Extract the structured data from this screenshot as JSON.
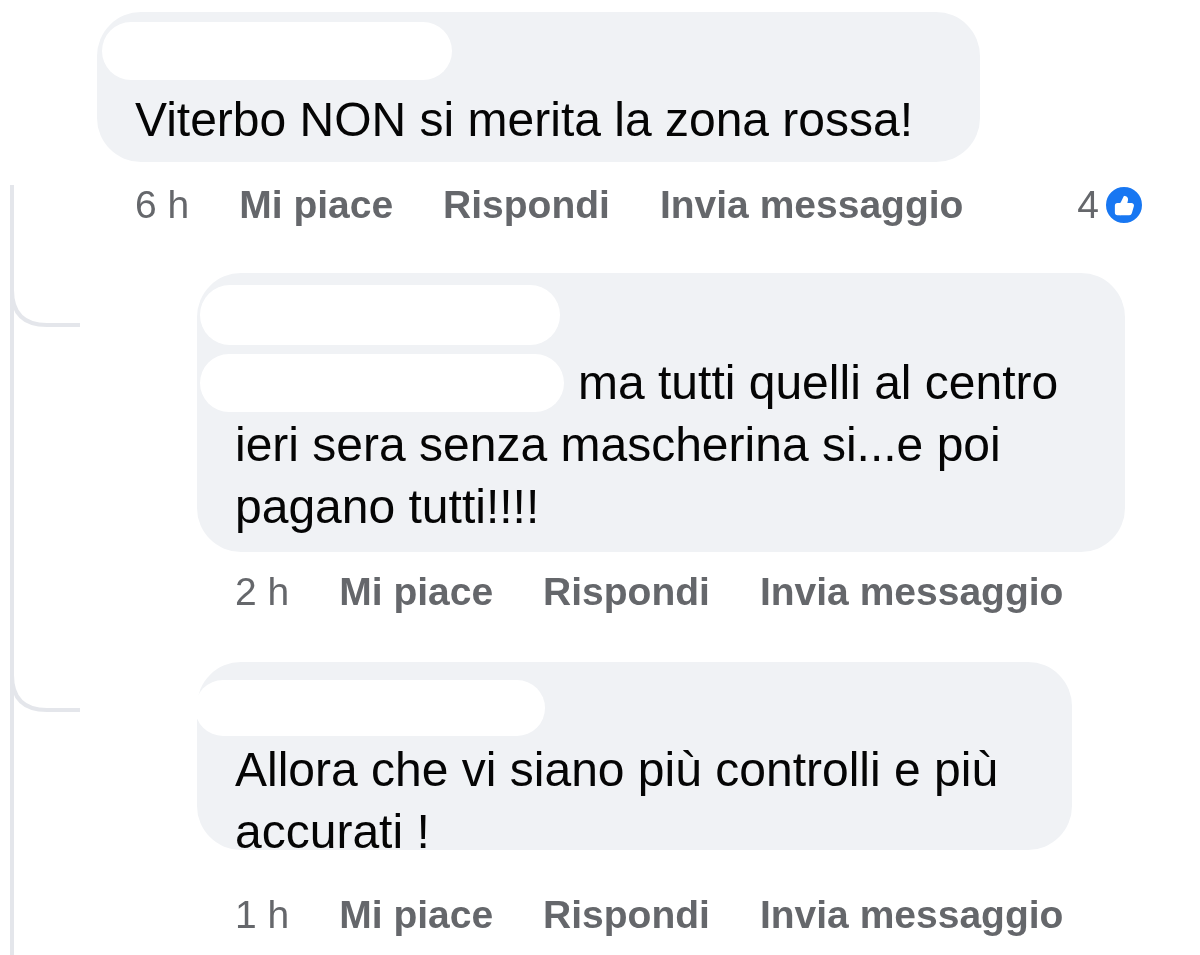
{
  "comments": [
    {
      "lines": [
        "Viterbo NON si merita la zona rossa!"
      ],
      "time": "6 h",
      "actions": [
        "Mi piace",
        "Rispondi",
        "Invia messaggio"
      ],
      "reactions": "4",
      "replies": [
        {
          "lines": [
            "ma tutti quelli al centro",
            "ieri sera senza mascherina si...e poi",
            "pagano tutti!!!!"
          ],
          "time": "2 h",
          "actions": [
            "Mi piace",
            "Rispondi",
            "Invia messaggio"
          ]
        },
        {
          "lines": [
            "Allora che vi siano più controlli e più",
            "accurati !"
          ],
          "time": "1 h",
          "actions": [
            "Mi piace",
            "Rispondi",
            "Invia messaggio"
          ]
        }
      ]
    }
  ]
}
